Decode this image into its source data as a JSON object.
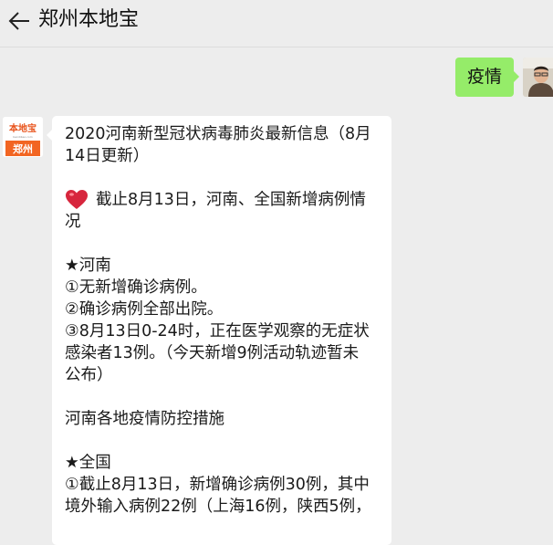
{
  "header": {
    "title": "郑州本地宝"
  },
  "user_message": {
    "text": "疫情"
  },
  "bot_avatar": {
    "top_text": "本地宝",
    "bottom_text": "郑州"
  },
  "bot_message": {
    "lines": [
      "2020河南新型冠状病毒肺炎最新信息（8月",
      "14日更新）",
      "",
      "截止8月13日，河南、全国新增病例情",
      "况",
      "",
      "★河南",
      "①无新增确诊病例。",
      "②确诊病例全部出院。",
      "③8月13日0-24时，正在医学观察的无症状",
      "感染者13例。（今天新增9例活动轨迹暂未",
      "公布）",
      "",
      "河南各地疫情防控措施",
      "",
      "★全国",
      "①截止8月13日，新增确诊病例30例，其中",
      "境外输入病例22例（上海16例，陕西5例，"
    ]
  },
  "colors": {
    "background": "#ededed",
    "user_bubble": "#95ec69",
    "bot_bubble": "#ffffff",
    "brand_orange": "#f26522"
  }
}
